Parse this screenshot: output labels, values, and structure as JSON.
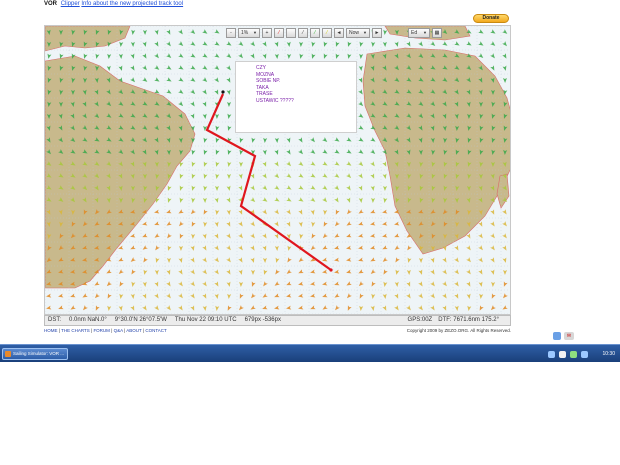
{
  "header": {
    "brand": "VOR",
    "links": [
      {
        "label": "Clipper"
      },
      {
        "label": "Info about the new projected track tool"
      }
    ],
    "donate_label": "Donate"
  },
  "toolbar": {
    "zoom_out": "-",
    "zoom_value": "1%",
    "zoom_in": "+",
    "time_prev": "◄",
    "time_value": "Now",
    "time_next": "►",
    "boat_value": "Ed"
  },
  "popup": {
    "lines": [
      "CZY",
      "MOZNA",
      "SOBIE NP.",
      "TAKA",
      "TRASE",
      "USTAWIC ?????"
    ]
  },
  "status": {
    "dst": "DST:",
    "distance": "0.0nm NaN.0°",
    "coords": "9°30.0'N 26°07.5'W",
    "time": "Thu Nov 22 09:10 UTC",
    "pixels": "679px -536px",
    "gps": "GPS:00Z",
    "dtf": "DTF: 7671.6nm 175.2°"
  },
  "footer": {
    "links": [
      "HOME",
      "THE CHARTS",
      "FORUM",
      "Q&A",
      "ABOUT",
      "CONTACT"
    ],
    "copyright": "Copyright 2009 by ZEZO.ORG. All Rights Reserved."
  },
  "taskbar": {
    "task_label": "Sailing Simulator: VOR ...",
    "clock": "10:30"
  },
  "colors": {
    "land": "#c8b98c",
    "route": "#e0161e",
    "wind_low": "#3aa84a",
    "wind_high": "#e08a22",
    "popup_text": "#7a1fa8"
  }
}
